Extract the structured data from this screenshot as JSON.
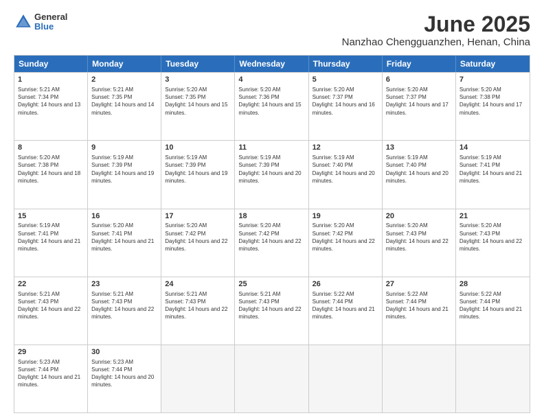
{
  "logo": {
    "general": "General",
    "blue": "Blue"
  },
  "title": "June 2025",
  "subtitle": "Nanzhao Chengguanzhen, Henan, China",
  "header_days": [
    "Sunday",
    "Monday",
    "Tuesday",
    "Wednesday",
    "Thursday",
    "Friday",
    "Saturday"
  ],
  "rows": [
    [
      {
        "day": "1",
        "rise": "Sunrise: 5:21 AM",
        "set": "Sunset: 7:34 PM",
        "daylight": "Daylight: 14 hours and 13 minutes."
      },
      {
        "day": "2",
        "rise": "Sunrise: 5:21 AM",
        "set": "Sunset: 7:35 PM",
        "daylight": "Daylight: 14 hours and 14 minutes."
      },
      {
        "day": "3",
        "rise": "Sunrise: 5:20 AM",
        "set": "Sunset: 7:35 PM",
        "daylight": "Daylight: 14 hours and 15 minutes."
      },
      {
        "day": "4",
        "rise": "Sunrise: 5:20 AM",
        "set": "Sunset: 7:36 PM",
        "daylight": "Daylight: 14 hours and 15 minutes."
      },
      {
        "day": "5",
        "rise": "Sunrise: 5:20 AM",
        "set": "Sunset: 7:37 PM",
        "daylight": "Daylight: 14 hours and 16 minutes."
      },
      {
        "day": "6",
        "rise": "Sunrise: 5:20 AM",
        "set": "Sunset: 7:37 PM",
        "daylight": "Daylight: 14 hours and 17 minutes."
      },
      {
        "day": "7",
        "rise": "Sunrise: 5:20 AM",
        "set": "Sunset: 7:38 PM",
        "daylight": "Daylight: 14 hours and 17 minutes."
      }
    ],
    [
      {
        "day": "8",
        "rise": "Sunrise: 5:20 AM",
        "set": "Sunset: 7:38 PM",
        "daylight": "Daylight: 14 hours and 18 minutes."
      },
      {
        "day": "9",
        "rise": "Sunrise: 5:19 AM",
        "set": "Sunset: 7:39 PM",
        "daylight": "Daylight: 14 hours and 19 minutes."
      },
      {
        "day": "10",
        "rise": "Sunrise: 5:19 AM",
        "set": "Sunset: 7:39 PM",
        "daylight": "Daylight: 14 hours and 19 minutes."
      },
      {
        "day": "11",
        "rise": "Sunrise: 5:19 AM",
        "set": "Sunset: 7:39 PM",
        "daylight": "Daylight: 14 hours and 20 minutes."
      },
      {
        "day": "12",
        "rise": "Sunrise: 5:19 AM",
        "set": "Sunset: 7:40 PM",
        "daylight": "Daylight: 14 hours and 20 minutes."
      },
      {
        "day": "13",
        "rise": "Sunrise: 5:19 AM",
        "set": "Sunset: 7:40 PM",
        "daylight": "Daylight: 14 hours and 20 minutes."
      },
      {
        "day": "14",
        "rise": "Sunrise: 5:19 AM",
        "set": "Sunset: 7:41 PM",
        "daylight": "Daylight: 14 hours and 21 minutes."
      }
    ],
    [
      {
        "day": "15",
        "rise": "Sunrise: 5:19 AM",
        "set": "Sunset: 7:41 PM",
        "daylight": "Daylight: 14 hours and 21 minutes."
      },
      {
        "day": "16",
        "rise": "Sunrise: 5:20 AM",
        "set": "Sunset: 7:41 PM",
        "daylight": "Daylight: 14 hours and 21 minutes."
      },
      {
        "day": "17",
        "rise": "Sunrise: 5:20 AM",
        "set": "Sunset: 7:42 PM",
        "daylight": "Daylight: 14 hours and 22 minutes."
      },
      {
        "day": "18",
        "rise": "Sunrise: 5:20 AM",
        "set": "Sunset: 7:42 PM",
        "daylight": "Daylight: 14 hours and 22 minutes."
      },
      {
        "day": "19",
        "rise": "Sunrise: 5:20 AM",
        "set": "Sunset: 7:42 PM",
        "daylight": "Daylight: 14 hours and 22 minutes."
      },
      {
        "day": "20",
        "rise": "Sunrise: 5:20 AM",
        "set": "Sunset: 7:43 PM",
        "daylight": "Daylight: 14 hours and 22 minutes."
      },
      {
        "day": "21",
        "rise": "Sunrise: 5:20 AM",
        "set": "Sunset: 7:43 PM",
        "daylight": "Daylight: 14 hours and 22 minutes."
      }
    ],
    [
      {
        "day": "22",
        "rise": "Sunrise: 5:21 AM",
        "set": "Sunset: 7:43 PM",
        "daylight": "Daylight: 14 hours and 22 minutes."
      },
      {
        "day": "23",
        "rise": "Sunrise: 5:21 AM",
        "set": "Sunset: 7:43 PM",
        "daylight": "Daylight: 14 hours and 22 minutes."
      },
      {
        "day": "24",
        "rise": "Sunrise: 5:21 AM",
        "set": "Sunset: 7:43 PM",
        "daylight": "Daylight: 14 hours and 22 minutes."
      },
      {
        "day": "25",
        "rise": "Sunrise: 5:21 AM",
        "set": "Sunset: 7:43 PM",
        "daylight": "Daylight: 14 hours and 22 minutes."
      },
      {
        "day": "26",
        "rise": "Sunrise: 5:22 AM",
        "set": "Sunset: 7:44 PM",
        "daylight": "Daylight: 14 hours and 21 minutes."
      },
      {
        "day": "27",
        "rise": "Sunrise: 5:22 AM",
        "set": "Sunset: 7:44 PM",
        "daylight": "Daylight: 14 hours and 21 minutes."
      },
      {
        "day": "28",
        "rise": "Sunrise: 5:22 AM",
        "set": "Sunset: 7:44 PM",
        "daylight": "Daylight: 14 hours and 21 minutes."
      }
    ],
    [
      {
        "day": "29",
        "rise": "Sunrise: 5:23 AM",
        "set": "Sunset: 7:44 PM",
        "daylight": "Daylight: 14 hours and 21 minutes."
      },
      {
        "day": "30",
        "rise": "Sunrise: 5:23 AM",
        "set": "Sunset: 7:44 PM",
        "daylight": "Daylight: 14 hours and 20 minutes."
      },
      {
        "day": "",
        "rise": "",
        "set": "",
        "daylight": ""
      },
      {
        "day": "",
        "rise": "",
        "set": "",
        "daylight": ""
      },
      {
        "day": "",
        "rise": "",
        "set": "",
        "daylight": ""
      },
      {
        "day": "",
        "rise": "",
        "set": "",
        "daylight": ""
      },
      {
        "day": "",
        "rise": "",
        "set": "",
        "daylight": ""
      }
    ]
  ]
}
